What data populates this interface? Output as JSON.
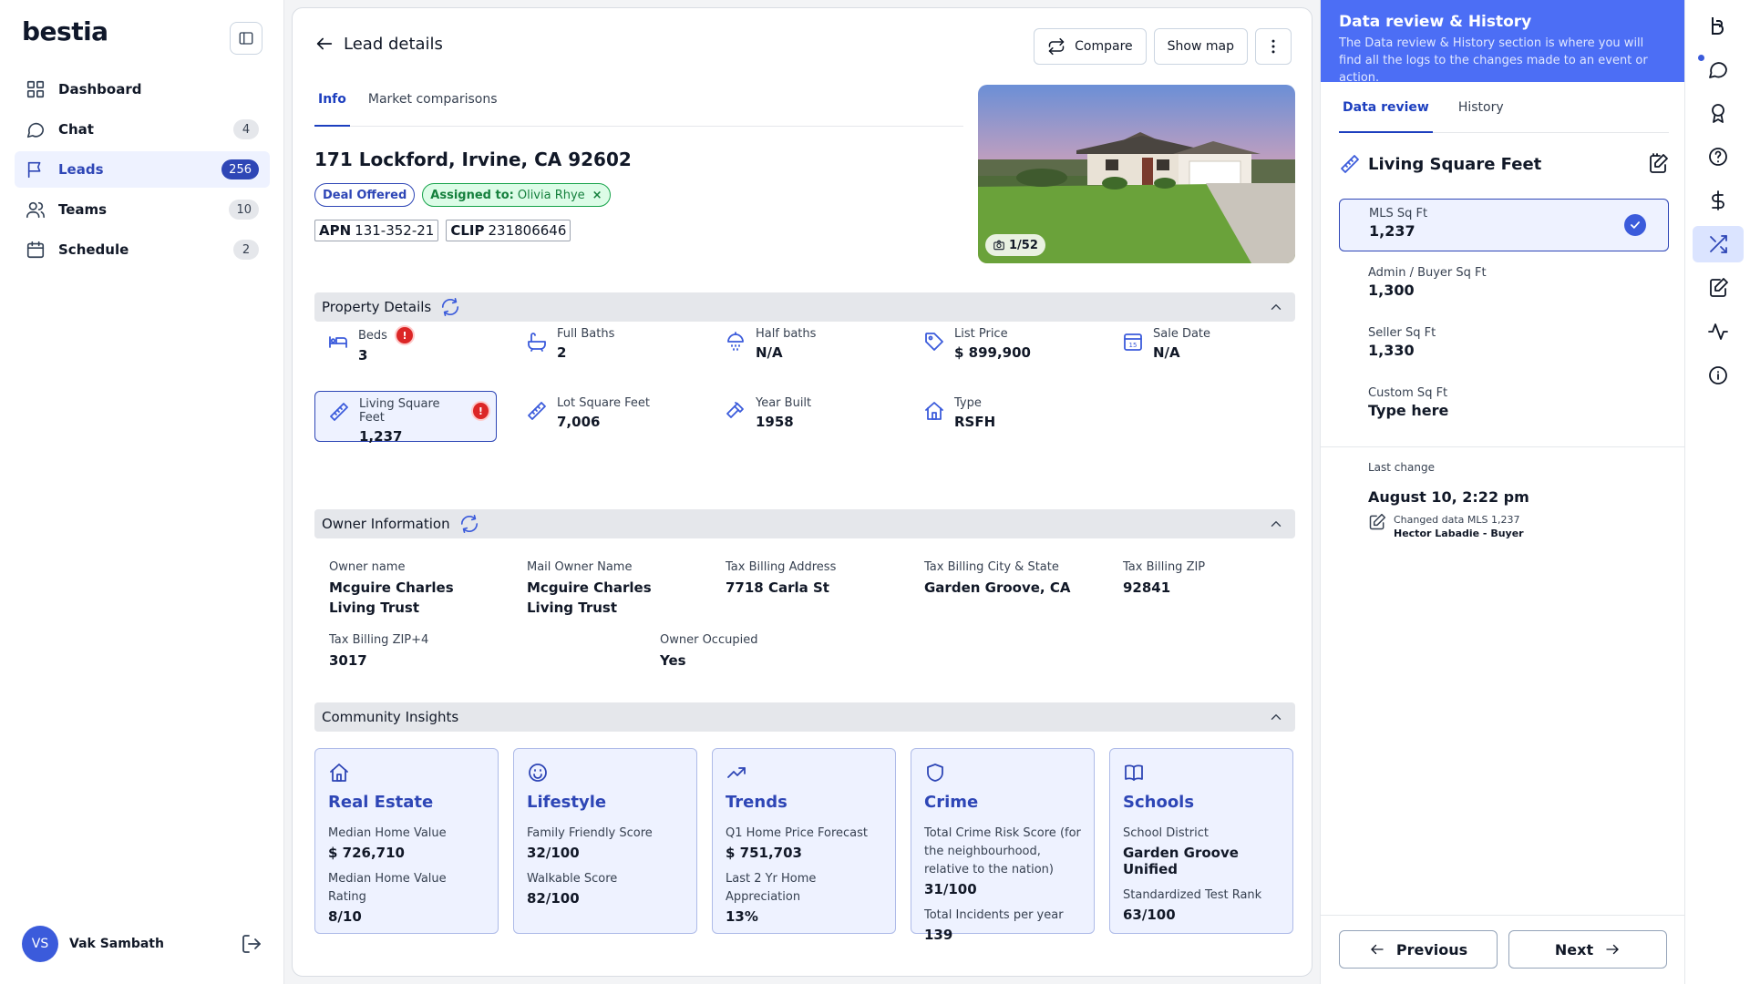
{
  "app": {
    "logo": "bestia"
  },
  "sidebar": {
    "items": [
      {
        "label": "Dashboard",
        "icon": "grid-icon",
        "badge": ""
      },
      {
        "label": "Chat",
        "icon": "chat-icon",
        "badge": "4"
      },
      {
        "label": "Leads",
        "icon": "flag-icon",
        "badge": "256",
        "active": true
      },
      {
        "label": "Teams",
        "icon": "users-icon",
        "badge": "10"
      },
      {
        "label": "Schedule",
        "icon": "calendar-icon",
        "badge": "2"
      }
    ],
    "user": {
      "initials": "VS",
      "name": "Vak Sambath"
    }
  },
  "header": {
    "title": "Lead details",
    "compare_label": "Compare",
    "map_label": "Show map"
  },
  "tabs": [
    {
      "label": "Info",
      "active": true
    },
    {
      "label": "Market comparisons",
      "active": false
    }
  ],
  "lead": {
    "address": "171 Lockford, Irvine, CA 92602",
    "status_tag": "Deal Offered",
    "assigned_label": "Assigned to:",
    "assigned_name": "Olivia Rhye",
    "assigned_remove": "×",
    "apn_label": "APN",
    "apn_value": "131-352-21",
    "clip_label": "CLIP",
    "clip_value": "231806646",
    "photo_count": "1/52"
  },
  "property": {
    "title": "Property Details",
    "items": [
      {
        "label": "Beds",
        "value": "3",
        "icon": "bed-icon",
        "warning": true
      },
      {
        "label": "Full Baths",
        "value": "2",
        "icon": "bath-icon"
      },
      {
        "label": "Half baths",
        "value": "N/A",
        "icon": "shower-icon"
      },
      {
        "label": "List Price",
        "value": "$ 899,900",
        "icon": "tag-icon"
      },
      {
        "label": "Sale Date",
        "value": "N/A",
        "icon": "calendar-15-icon"
      },
      {
        "label": "Living Square Feet",
        "value": "1,237",
        "icon": "ruler-icon",
        "warning": true,
        "selected": true
      },
      {
        "label": "Lot Square Feet",
        "value": "7,006",
        "icon": "ruler-icon"
      },
      {
        "label": "Year Built",
        "value": "1958",
        "icon": "hammer-icon"
      },
      {
        "label": "Type",
        "value": "RSFH",
        "icon": "home-icon"
      }
    ],
    "warning_glyph": "!"
  },
  "owner": {
    "title": "Owner Information",
    "items": [
      {
        "label": "Owner name",
        "value": "Mcguire Charles Living Trust"
      },
      {
        "label": "Mail Owner Name",
        "value": "Mcguire Charles Living Trust"
      },
      {
        "label": "Tax Billing Address",
        "value": "7718 Carla St"
      },
      {
        "label": "Tax Billing City & State",
        "value": "Garden Groove, CA"
      },
      {
        "label": "Tax Billing ZIP",
        "value": "92841"
      },
      {
        "label": "Tax Billing ZIP+4",
        "value": "3017"
      },
      {
        "label": "Owner Occupied",
        "value": "Yes"
      }
    ]
  },
  "community": {
    "title": "Community Insights",
    "cards": [
      {
        "title": "Real Estate",
        "icon": "home-icon",
        "rows": [
          {
            "label": "Median Home Value",
            "value": "$ 726,710"
          },
          {
            "label": "Median Home Value Rating",
            "value": "8/10"
          }
        ]
      },
      {
        "title": "Lifestyle",
        "icon": "smile-icon",
        "rows": [
          {
            "label": "Family Friendly Score",
            "value": "32/100"
          },
          {
            "label": "Walkable Score",
            "value": "82/100"
          }
        ]
      },
      {
        "title": "Trends",
        "icon": "trend-up-icon",
        "rows": [
          {
            "label": "Q1 Home Price Forecast",
            "value": "$ 751,703"
          },
          {
            "label": "Last 2 Yr Home Appreciation",
            "value": "13%"
          }
        ]
      },
      {
        "title": "Crime",
        "icon": "shield-icon",
        "rows": [
          {
            "label": "Total Crime Risk Score (for the neighbourhood, relative to the nation)",
            "value": "31/100"
          },
          {
            "label": "Total Incidents per year",
            "value": "139"
          }
        ]
      },
      {
        "title": "Schools",
        "icon": "book-icon",
        "rows": [
          {
            "label": "School District",
            "value": "Garden Groove Unified"
          },
          {
            "label": "Standardized Test Rank",
            "value": "63/100"
          }
        ]
      }
    ]
  },
  "review": {
    "title": "Data review & History",
    "description": "The Data review & History section is where you will find all the logs to the changes made to an event or action.",
    "tabs": [
      {
        "label": "Data review",
        "active": true
      },
      {
        "label": "History",
        "active": false
      }
    ],
    "field_title": "Living Square Feet",
    "options": [
      {
        "label": "MLS Sq Ft",
        "value": "1,237",
        "selected": true
      },
      {
        "label": "Admin / Buyer Sq Ft",
        "value": "1,300"
      },
      {
        "label": "Seller Sq Ft",
        "value": "1,330"
      },
      {
        "label": "Custom Sq Ft",
        "value": "Type here"
      }
    ],
    "last_change_label": "Last change",
    "last_change_date": "August 10, 2:22 pm",
    "last_change_text": "Changed data MLS 1,237",
    "last_change_who": "Hector Labadie - Buyer",
    "previous_label": "Previous",
    "next_label": "Next"
  },
  "rail": [
    "brand-icon",
    "chat-icon",
    "award-icon",
    "help-icon",
    "dollar-icon",
    "shuffle-icon",
    "edit-note-icon",
    "activity-icon",
    "info-icon"
  ],
  "colors": {
    "accent": "#2e46b6",
    "header_blue": "#4c6ef5",
    "warning": "#dc2626",
    "success": "#16a34a"
  }
}
